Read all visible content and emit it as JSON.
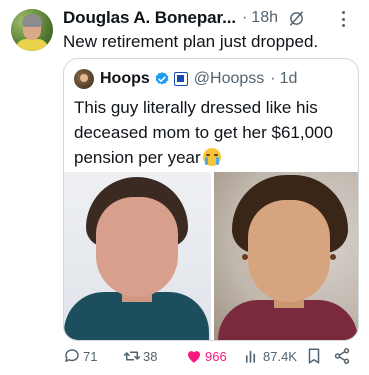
{
  "post": {
    "author_name": "Douglas A. Bonepar...",
    "separator": "·",
    "time": "18h",
    "text": "New retirement plan just dropped.",
    "icons": [
      "grok-icon",
      "more-icon"
    ]
  },
  "quoted": {
    "name": "Hoops",
    "handle": "@Hoopss",
    "separator": "·",
    "time": "1d",
    "text": "This guy literally dressed like his deceased mom to get her $61,000 pension per year",
    "emoji": "crying-face",
    "media": [
      "photo-left",
      "photo-right"
    ]
  },
  "actions": {
    "replies": "71",
    "reposts": "38",
    "likes": "966",
    "views": "87.4K"
  },
  "colors": {
    "text": "#0f1419",
    "muted": "#536471",
    "like": "#f91880",
    "verified": "#1d9bf0",
    "border": "#cfd9de"
  }
}
